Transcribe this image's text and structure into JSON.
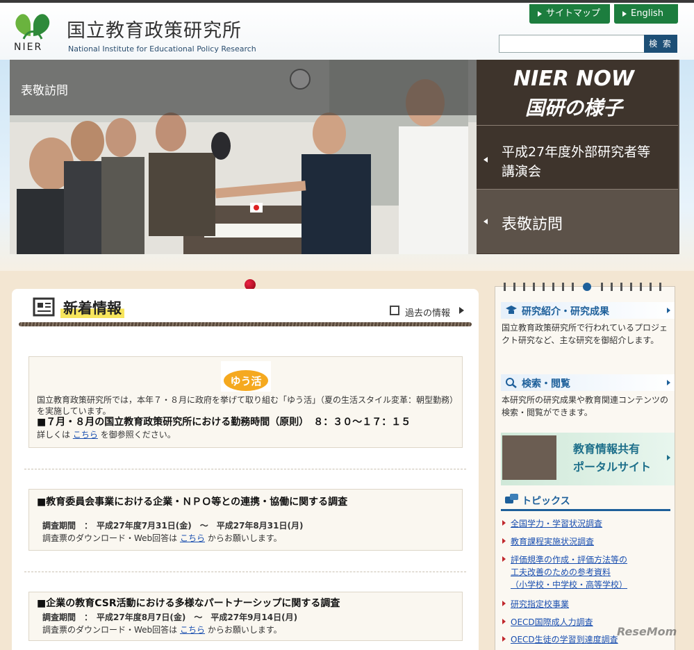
{
  "header": {
    "logo_text": "NIER",
    "title": "国立教育政策研究所",
    "subtitle": "National Institute for Educational Policy Research",
    "sitemap_label": "サイトマップ",
    "english_label": "English",
    "search_placeholder": "",
    "search_button": "検 索"
  },
  "hero": {
    "caption": "表敬訪問",
    "panel_title_1": "NIER NOW",
    "panel_title_2": "国研の様子",
    "items": [
      {
        "label_line1": "平成27年度外部研究者等",
        "label_line2": "講演会"
      },
      {
        "label_line1": "表敬訪問",
        "label_line2": ""
      }
    ]
  },
  "news": {
    "title": "新着情報",
    "past_link": "過去の情報",
    "yukatsu_badge": "ゆう活",
    "item1": {
      "text": "国立教育政策研究所では，本年７・８月に政府を挙げて取り組む「ゆう活」（夏の生活スタイル変革：朝型勤務）を実施しています。",
      "headline": "■７月・８月の国立教育政策研究所における勤務時間（原則）　８：３０～１７：１５",
      "detail_prefix": "詳しくは",
      "link": "こちら",
      "detail_suffix": "を御参照ください。"
    },
    "item2": {
      "headline": "■教育委員会事業における企業・ＮＰＯ等との連携・協働に関する調査",
      "period": "調査期間　：　平成27年度7月31日(金)　～　平成27年8月31日(月)",
      "detail_prefix": "調査票のダウンロード・Web回答は",
      "link": "こちら",
      "detail_suffix": "からお願いします。"
    },
    "item3": {
      "headline": "■企業の教育CSR活動における多様なパートナーシップに関する調査",
      "period": "調査期間　：　平成27年度8月7日(金)　～　平成27年9月14日(月)",
      "detail_prefix": "調査票のダウンロード・Web回答は",
      "link": "こちら",
      "detail_suffix": "からお願いします。"
    }
  },
  "sidebar": {
    "research_title": "研究紹介・研究成果",
    "research_text": "国立教育政策研究所で行われているプロジェクト研究など、主な研究を御紹介します。",
    "search_title": "検索・閲覧",
    "search_text": "本研究所の研究成果や教育関連コンテンツの検索・閲覧ができます。",
    "portal_line1": "教育情報共有",
    "portal_line2": "ポータルサイト",
    "topics_title": "トピックス",
    "topics": [
      "全国学力・学習状況調査",
      "教育課程実施状況調査",
      "評価規準の作成・評価方法等の",
      "工夫改善のための参考資料",
      "（小学校・中学校・高等学校）",
      "研究指定校事業",
      "OECD国際成人力調査",
      "OECD生徒の学習到達度調査"
    ]
  },
  "watermark": "ReseMom",
  "colors": {
    "green": "#1c7d3e",
    "navy": "#1d4f76",
    "brown_panel": "#3e342c"
  }
}
